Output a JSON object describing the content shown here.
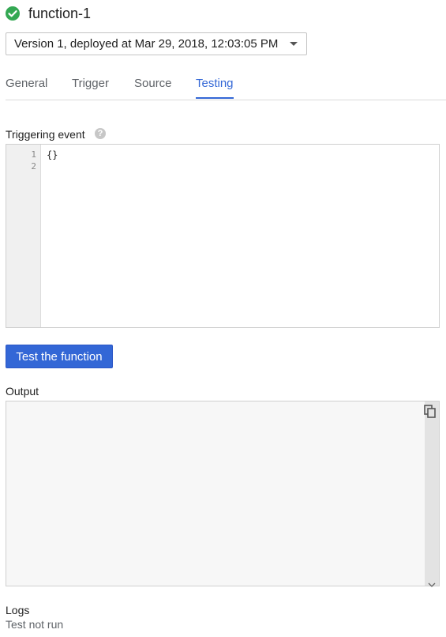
{
  "header": {
    "title": "function-1",
    "status_icon": "check-circle-icon",
    "status_color": "#34a853"
  },
  "version_select": {
    "value": "Version 1, deployed at Mar 29, 2018, 12:03:05 PM"
  },
  "tabs": [
    {
      "label": "General",
      "active": false
    },
    {
      "label": "Trigger",
      "active": false
    },
    {
      "label": "Source",
      "active": false
    },
    {
      "label": "Testing",
      "active": true
    }
  ],
  "triggering_event": {
    "label": "Triggering event",
    "help_icon": "help-icon",
    "lines": [
      {
        "number": "1",
        "text": "{}"
      },
      {
        "number": "2",
        "text": ""
      }
    ]
  },
  "test_button": {
    "label": "Test the function"
  },
  "output": {
    "label": "Output",
    "copy_icon": "copy-icon",
    "value": ""
  },
  "logs": {
    "label": "Logs",
    "value": "Test not run"
  },
  "colors": {
    "accent": "#3367d6",
    "success": "#34a853"
  }
}
